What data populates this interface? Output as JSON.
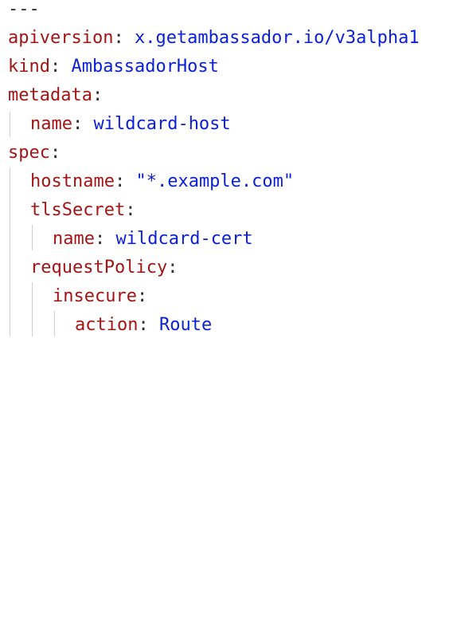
{
  "document": {
    "separator": "---",
    "lines": [
      {
        "key": "apiversion",
        "value": "x.getambassador.io/v3alpha1"
      },
      {
        "key": "kind",
        "value": "AmbassadorHost"
      },
      {
        "key": "metadata",
        "value": ""
      },
      {
        "key": "name",
        "value": "wildcard-host"
      },
      {
        "key": "spec",
        "value": ""
      },
      {
        "key": "hostname",
        "value": "\"*.example.com\""
      },
      {
        "key": "tlsSecret",
        "value": ""
      },
      {
        "key": "name",
        "value": "wildcard-cert"
      },
      {
        "key": "requestPolicy",
        "value": ""
      },
      {
        "key": "insecure",
        "value": ""
      },
      {
        "key": "action",
        "value": "Route"
      }
    ]
  },
  "colors": {
    "key": "#a31515",
    "value": "#0a1fd6",
    "punctuation": "#2b2b2b",
    "indent_guide": "#cfcfcf",
    "background": "#ffffff"
  }
}
